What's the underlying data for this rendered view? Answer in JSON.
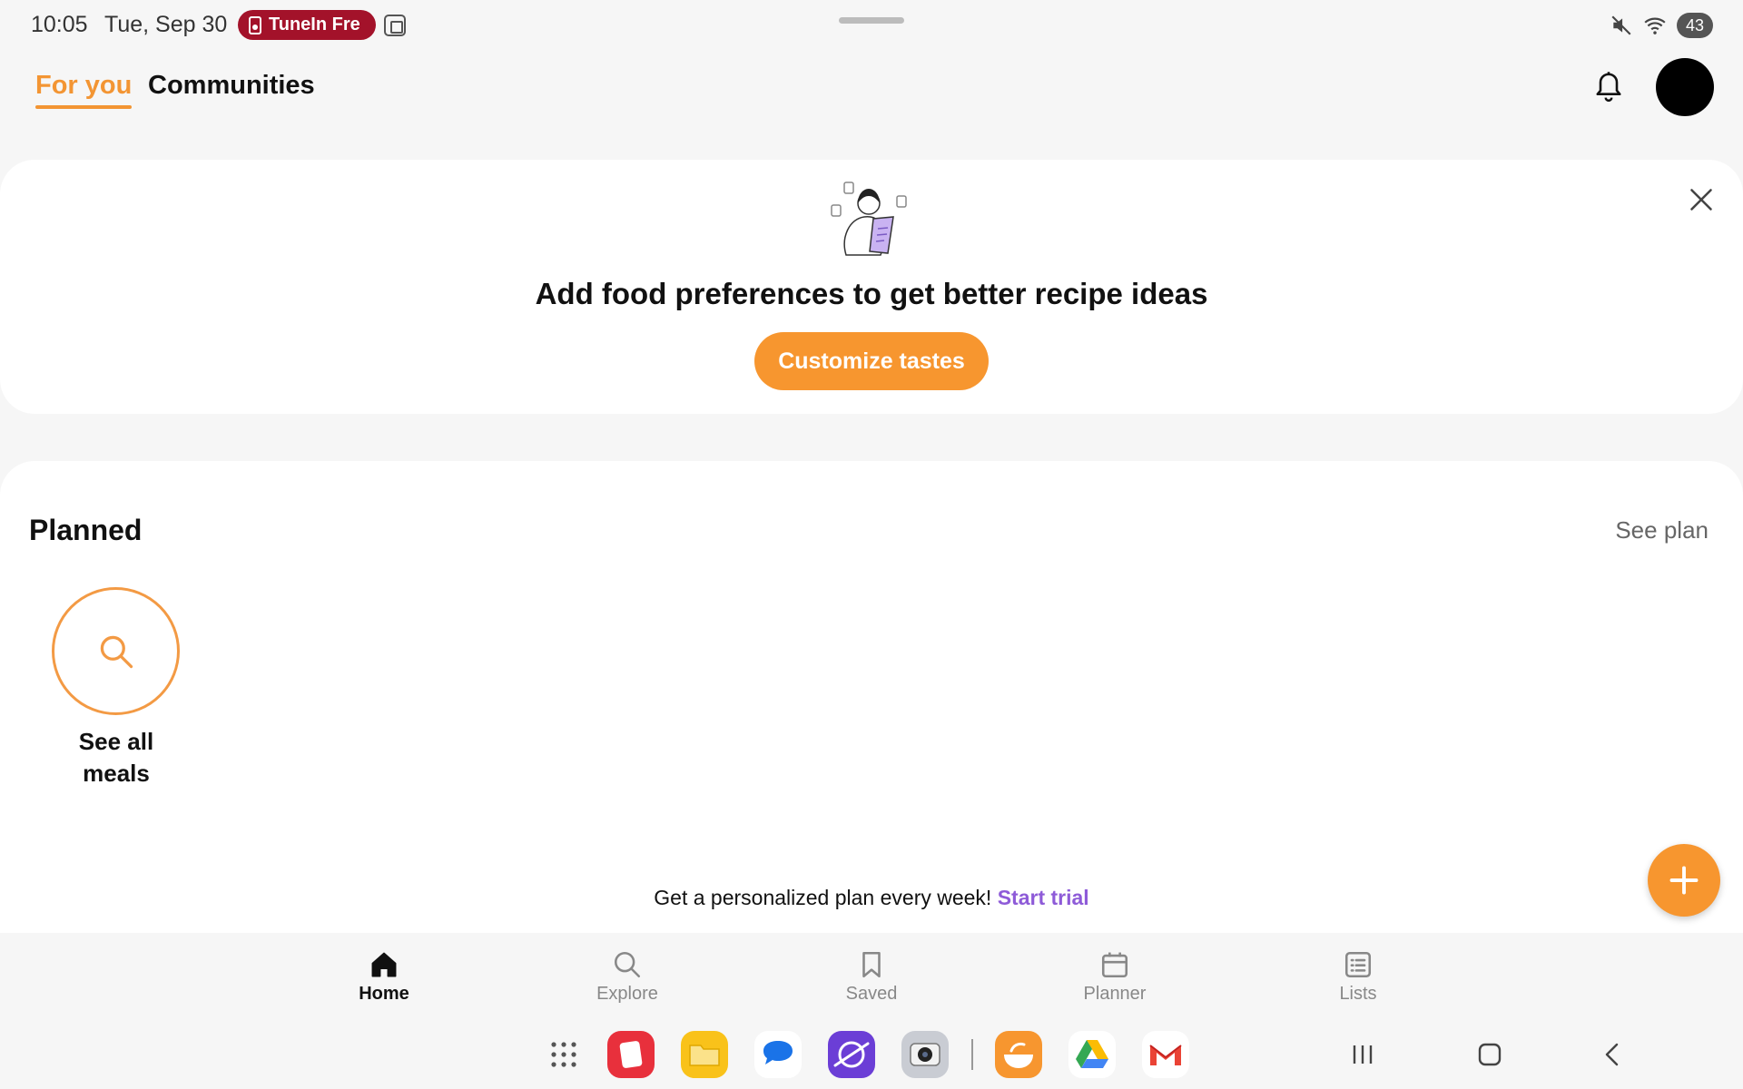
{
  "status_bar": {
    "time": "10:05",
    "date": "Tue, Sep 30",
    "notification_pill": "TuneIn Fre",
    "battery": "43"
  },
  "header": {
    "tabs": [
      {
        "label": "For you",
        "active": true
      },
      {
        "label": "Communities",
        "active": false
      }
    ]
  },
  "preferences_card": {
    "title": "Add food preferences to get better recipe ideas",
    "button_label": "Customize tastes"
  },
  "planned": {
    "title": "Planned",
    "see_plan_label": "See plan",
    "see_all_meals_label": "See all meals",
    "promo_text": "Get a personalized plan every week!",
    "promo_link": "Start trial"
  },
  "bottom_nav": {
    "items": [
      {
        "label": "Home",
        "icon": "home-icon",
        "active": true
      },
      {
        "label": "Explore",
        "icon": "search-icon",
        "active": false
      },
      {
        "label": "Saved",
        "icon": "bookmark-icon",
        "active": false
      },
      {
        "label": "Planner",
        "icon": "calendar-icon",
        "active": false
      },
      {
        "label": "Lists",
        "icon": "list-icon",
        "active": false
      }
    ]
  },
  "colors": {
    "accent": "#f7962f",
    "link": "#8e5bd8",
    "background": "#f6f6f6",
    "card": "#ffffff"
  }
}
